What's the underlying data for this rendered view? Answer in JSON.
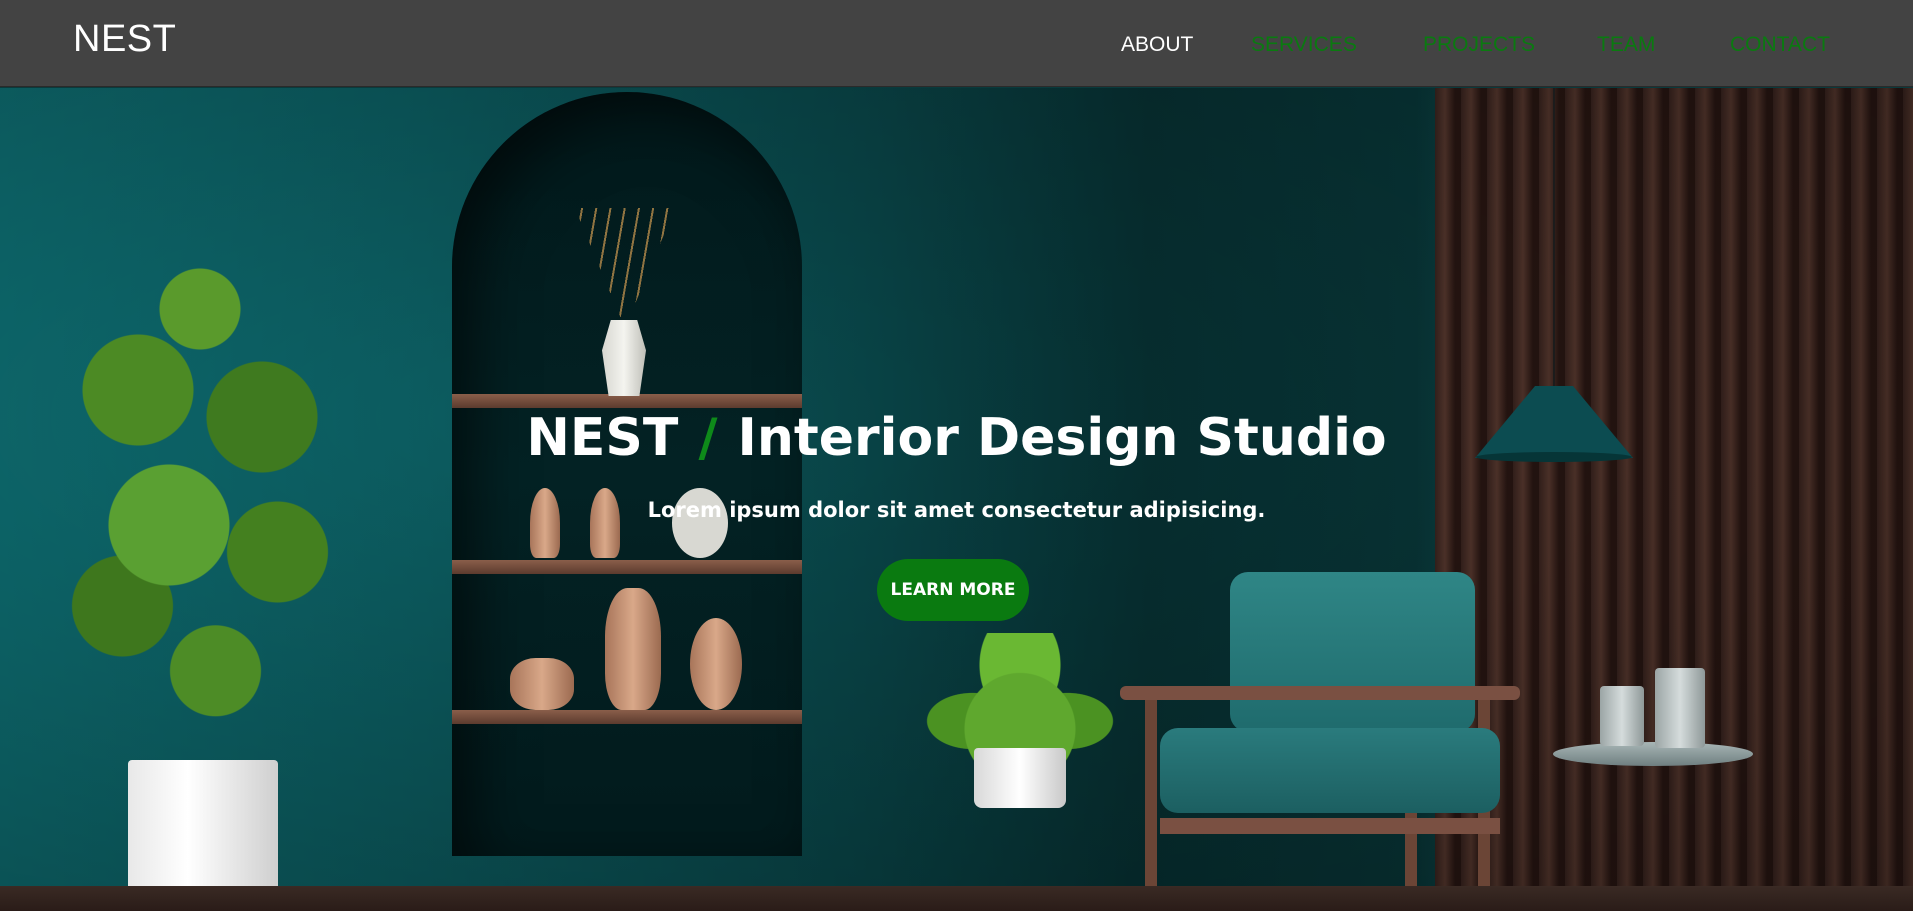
{
  "header": {
    "logo": "NEST",
    "nav": [
      {
        "label": "ABOUT",
        "color": "#ffffff"
      },
      {
        "label": "SERVICES",
        "color": "#0a7a10"
      },
      {
        "label": "PROJECTS",
        "color": "#0a7a10"
      },
      {
        "label": "TEAM",
        "color": "#0a7a10"
      },
      {
        "label": "CONTACT",
        "color": "#0a7a10"
      }
    ]
  },
  "hero": {
    "title_brand": "NEST",
    "title_slash": "/",
    "title_rest": "Interior Design Studio",
    "subtitle": "Lorem ipsum dolor sit amet consectetur adipisicing.",
    "cta_label": "LEARN MORE",
    "background_image": "interior-room-teal-wall-arch-shelves-chair-plants"
  },
  "colors": {
    "navbar_bg": "#434343",
    "accent_green": "#0a7a10",
    "text_white": "#ffffff"
  }
}
